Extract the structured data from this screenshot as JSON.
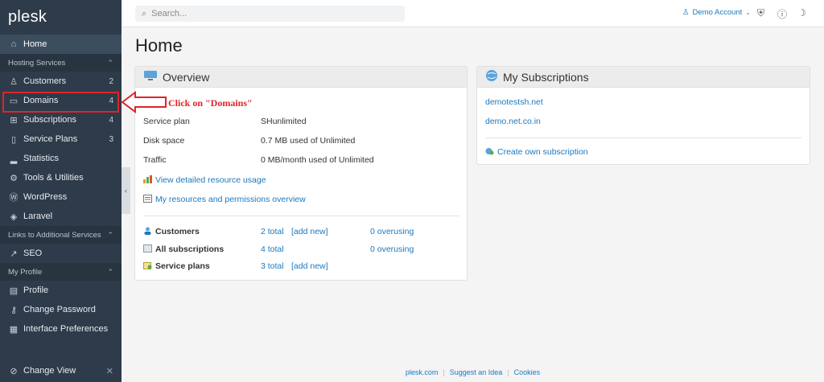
{
  "app": {
    "logo": "plesk"
  },
  "sidebar": {
    "home": {
      "label": "Home",
      "icon": "home-icon"
    },
    "groups": [
      {
        "title": "Hosting Services",
        "items": [
          {
            "label": "Customers",
            "count": "2",
            "icon": "user-icon"
          },
          {
            "label": "Domains",
            "count": "4",
            "icon": "monitor-icon"
          },
          {
            "label": "Subscriptions",
            "count": "4",
            "icon": "grid-icon"
          },
          {
            "label": "Service Plans",
            "count": "3",
            "icon": "book-icon"
          },
          {
            "label": "Statistics",
            "count": "",
            "icon": "chart-icon"
          },
          {
            "label": "Tools & Utilities",
            "count": "",
            "icon": "sliders-icon"
          },
          {
            "label": "WordPress",
            "count": "",
            "icon": "wordpress-icon"
          },
          {
            "label": "Laravel",
            "count": "",
            "icon": "laravel-icon"
          }
        ]
      },
      {
        "title": "Links to Additional Services",
        "items": [
          {
            "label": "SEO",
            "count": "",
            "icon": "seo-icon"
          }
        ]
      },
      {
        "title": "My Profile",
        "items": [
          {
            "label": "Profile",
            "count": "",
            "icon": "profile-icon"
          },
          {
            "label": "Change Password",
            "count": "",
            "icon": "key-icon"
          },
          {
            "label": "Interface Preferences",
            "count": "",
            "icon": "preferences-icon"
          }
        ]
      }
    ],
    "footer": {
      "label": "Change View"
    }
  },
  "topbar": {
    "search_placeholder": "Search...",
    "account_label": "Demo Account"
  },
  "main": {
    "title": "Home",
    "overview": {
      "title": "Overview",
      "rows": [
        {
          "label": "Service plan",
          "value": "SHunlimited"
        },
        {
          "label": "Disk space",
          "value": "0.7 MB used of Unlimited"
        },
        {
          "label": "Traffic",
          "value": "0 MB/month used of Unlimited"
        }
      ],
      "links": {
        "resource_usage": "View detailed resource usage",
        "permissions": "My resources and permissions overview"
      },
      "summary": [
        {
          "label": "Customers",
          "total": "2 total",
          "add": "[add new]",
          "overusing": "0 overusing"
        },
        {
          "label": "All subscriptions",
          "total": "4 total",
          "add": "",
          "overusing": "0 overusing"
        },
        {
          "label": "Service plans",
          "total": "3 total",
          "add": "[add new]",
          "overusing": ""
        }
      ]
    },
    "subscriptions": {
      "title": "My Subscriptions",
      "items": [
        "demotestsh.net",
        "demo.net.co.in"
      ],
      "create_link": "Create own subscription"
    }
  },
  "annotation": {
    "text": "Click on \"Domains\"",
    "color": "#e0232b"
  },
  "footer": {
    "links": [
      "plesk.com",
      "Suggest an Idea",
      "Cookies"
    ]
  },
  "colors": {
    "sidebar": "#2e3b4a",
    "link": "#1b79c0",
    "accent": "#e0232b"
  }
}
